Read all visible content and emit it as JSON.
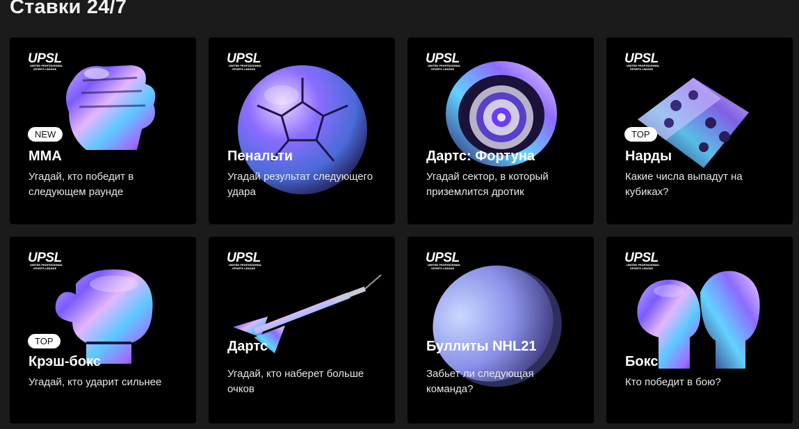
{
  "page_title": "Ставки 24/7",
  "logo": {
    "text": "UPSL",
    "subtitle_line1": "UNITED PROFESSIONAL",
    "subtitle_line2": "SPORTS LEAGUE"
  },
  "cards": [
    {
      "title": "MMA",
      "description": "Угадай, кто победит в следующем раунде",
      "badge": "NEW",
      "icon": "mma-glove-icon"
    },
    {
      "title": "Пенальти",
      "description": "Угадай результат следующего удара",
      "badge": "",
      "icon": "soccer-ball-icon"
    },
    {
      "title": "Дартс: Фортуна",
      "description": "Угадай сектор, в который приземлится дротик",
      "badge": "",
      "icon": "dartboard-icon"
    },
    {
      "title": "Нарды",
      "description": "Какие числа выпадут на кубиках?",
      "badge": "TOP",
      "icon": "dice-icon"
    },
    {
      "title": "Крэш-бокс",
      "description": "Угадай, кто ударит сильнее",
      "badge": "TOP",
      "icon": "boxing-glove-icon"
    },
    {
      "title": "Дартс",
      "description": "Угадай, кто наберет больше очков",
      "badge": "",
      "icon": "dart-icon"
    },
    {
      "title": "Буллиты NHL21",
      "description": "Забьет ли следующая команда?",
      "badge": "",
      "icon": "hockey-puck-icon"
    },
    {
      "title": "Бокс",
      "description": "Кто победит в бою?",
      "badge": "",
      "icon": "boxing-gloves-pair-icon"
    }
  ]
}
